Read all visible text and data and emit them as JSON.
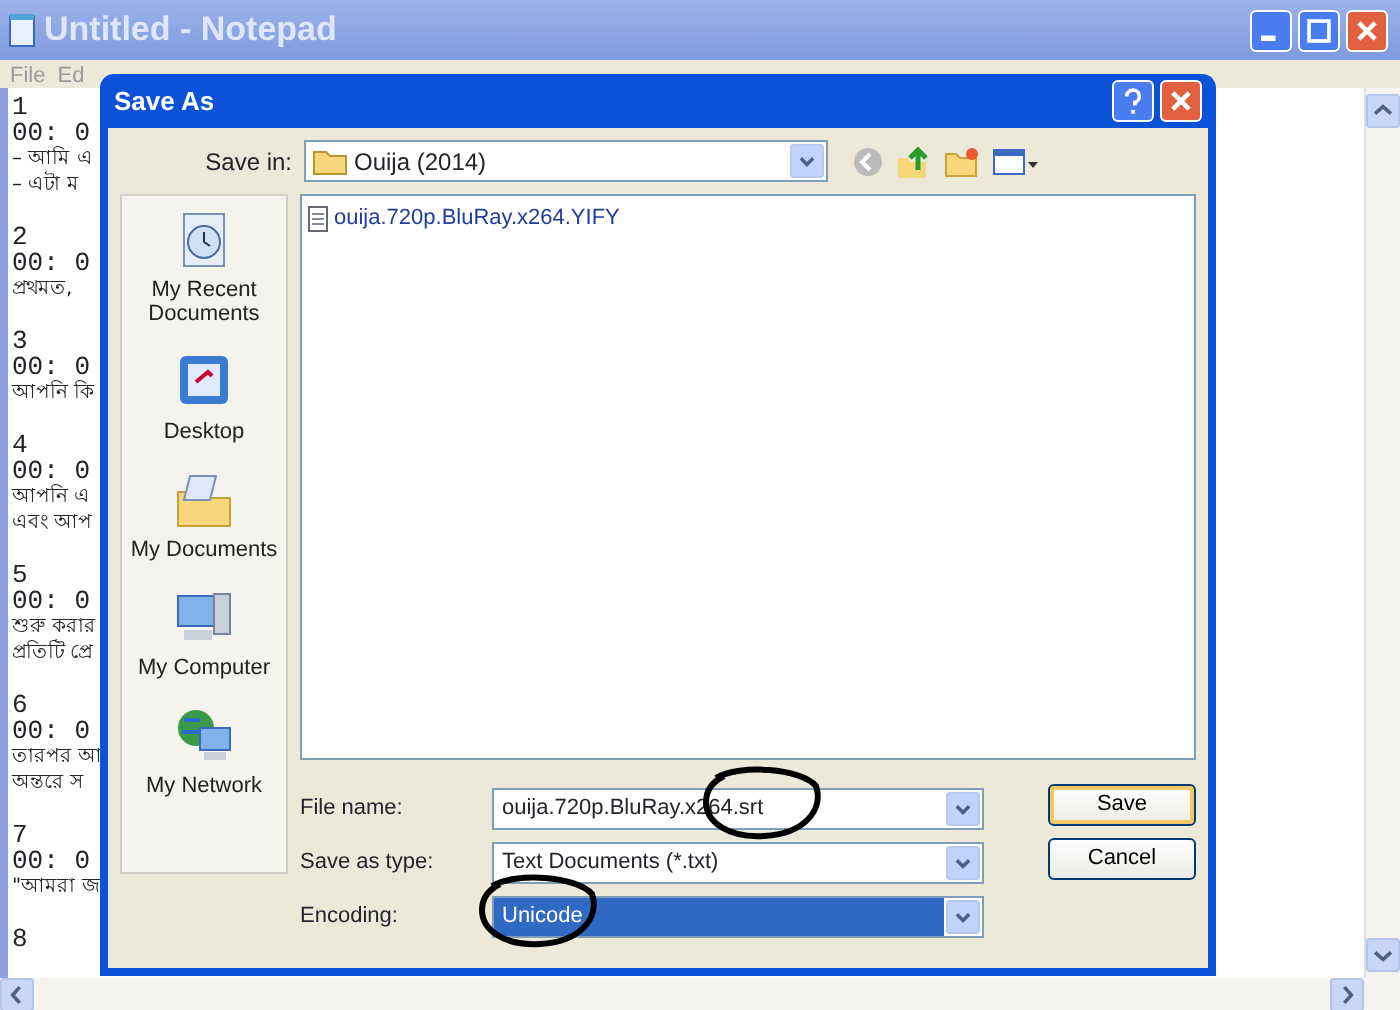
{
  "notepad": {
    "title": "Untitled - Notepad",
    "active": false,
    "menu": [
      "File",
      "Ed"
    ],
    "blocks": [
      {
        "number": "1",
        "time": "00: 0",
        "lines": [
          "– আমি এ",
          "– এটা ম"
        ]
      },
      {
        "number": "2",
        "time": "00: 0",
        "lines": [
          "প্রথমত,"
        ]
      },
      {
        "number": "3",
        "time": "00: 0",
        "lines": [
          "আপনি কি"
        ]
      },
      {
        "number": "4",
        "time": "00: 0",
        "lines": [
          "আপনি এ",
          "এবং আপ"
        ]
      },
      {
        "number": "5",
        "time": "00: 0",
        "lines": [
          "শুরু করার",
          "প্রতিটি প্রে"
        ]
      },
      {
        "number": "6",
        "time": "00: 0",
        "lines": [
          "তারপর আ",
          "অন্তরে স"
        ]
      },
      {
        "number": "7",
        "time": "00: 0",
        "lines": [
          "\"আমরা জ"
        ]
      },
      {
        "number": "8"
      }
    ]
  },
  "dialog": {
    "title": "Save As",
    "save_in": {
      "label": "Save in:",
      "value": "Ouija (2014)"
    },
    "places": [
      {
        "kind": "recent",
        "label": "My Recent Documents"
      },
      {
        "kind": "desktop",
        "label": "Desktop"
      },
      {
        "kind": "documents",
        "label": "My Documents"
      },
      {
        "kind": "computer",
        "label": "My Computer"
      },
      {
        "kind": "network",
        "label": "My Network"
      }
    ],
    "files": [
      {
        "name": "ouija.720p.BluRay.x264.YIFY",
        "selected": false
      }
    ],
    "fields": [
      {
        "label": "File name:",
        "value": "ouija.720p.BluRay.x264.srt",
        "selected": false,
        "circled": true
      },
      {
        "label": "Save as type:",
        "value": "Text Documents (*.txt)",
        "selected": false,
        "circled": false
      },
      {
        "label": "Encoding:",
        "value": "Unicode",
        "selected": true,
        "circled": true
      }
    ],
    "buttons": [
      {
        "label": "Save",
        "default": true
      },
      {
        "label": "Cancel",
        "default": false
      }
    ]
  }
}
